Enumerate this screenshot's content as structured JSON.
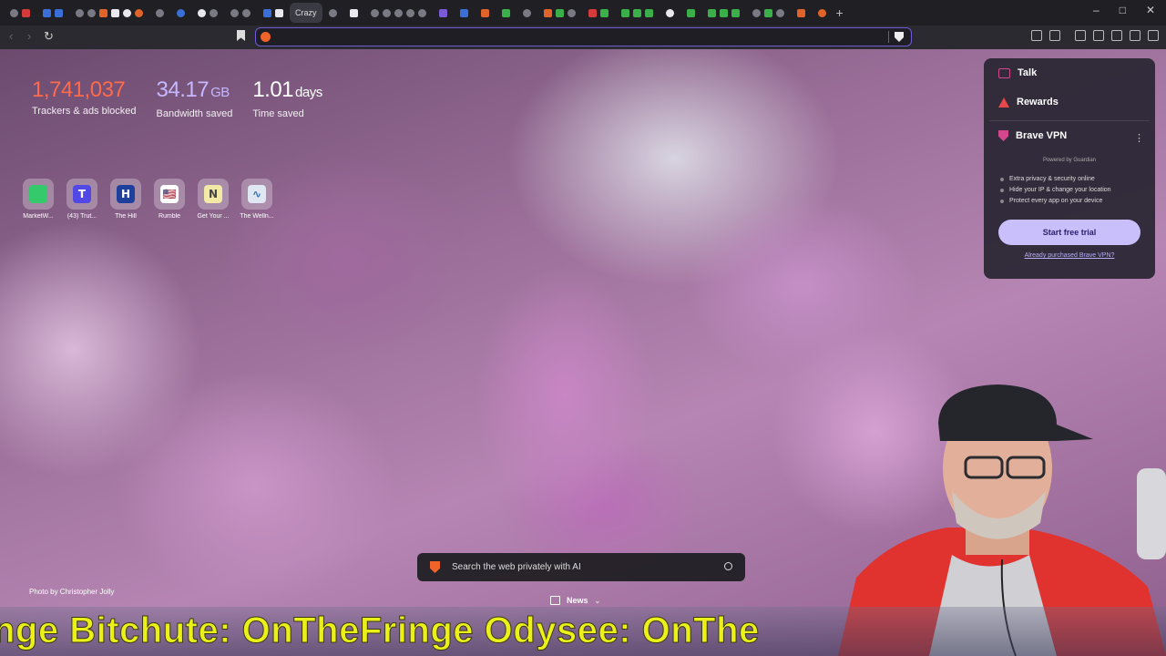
{
  "tabs": {
    "active_tab_title": "Crazy",
    "new_tab_icon": "plus-icon"
  },
  "window_controls": {
    "minimize": "–",
    "maximize": "□",
    "close": "✕"
  },
  "toolbar": {
    "back_glyph": "‹",
    "forward_glyph": "›",
    "reload_glyph": "↻",
    "url_value": ""
  },
  "stats": {
    "trackers_value": "1,741,037",
    "trackers_label": "Trackers & ads blocked",
    "bandwidth_value": "34.17",
    "bandwidth_unit": "GB",
    "bandwidth_label": "Bandwidth saved",
    "time_value": "1.01",
    "time_unit": "days",
    "time_label": "Time saved"
  },
  "top_sites": [
    {
      "label": "MarketW...",
      "glyph": "",
      "color": "#34c96a"
    },
    {
      "label": "(43) Trut...",
      "glyph": "T",
      "color": "#5248e6"
    },
    {
      "label": "The Hill",
      "glyph": "H",
      "color": "#1f3f9c"
    },
    {
      "label": "Rumble",
      "glyph": "🇺🇸",
      "color": "#ffffff"
    },
    {
      "label": "Get Your ...",
      "glyph": "N",
      "color": "#f2e9a6"
    },
    {
      "label": "The Welln...",
      "glyph": "∿",
      "color": "#dfe8f2"
    }
  ],
  "panel": {
    "talk_label": "Talk",
    "rewards_label": "Rewards",
    "vpn_title": "Brave VPN",
    "vpn_more": "⋮",
    "powered_by": "Powered by Guardian",
    "features": [
      "Extra privacy & security online",
      "Hide your IP & change your location",
      "Protect every app on your device"
    ],
    "trial_button": "Start free trial",
    "purchased_link": "Already purchased Brave VPN?"
  },
  "search": {
    "placeholder": "Search the web privately with AI"
  },
  "news": {
    "label": "News",
    "chevron": "⌄"
  },
  "photo_credit": "Photo by Christopher Jolly",
  "ticker": {
    "text": "nge Bitchute: OnTheFringe Odysee: OnThe"
  },
  "colors": {
    "trackers": "#ff6a4a",
    "bandwidth": "#c5b8ff",
    "accent": "#6e5bd8",
    "ticker": "#ecf01a",
    "brave_orange": "#f0642a"
  }
}
